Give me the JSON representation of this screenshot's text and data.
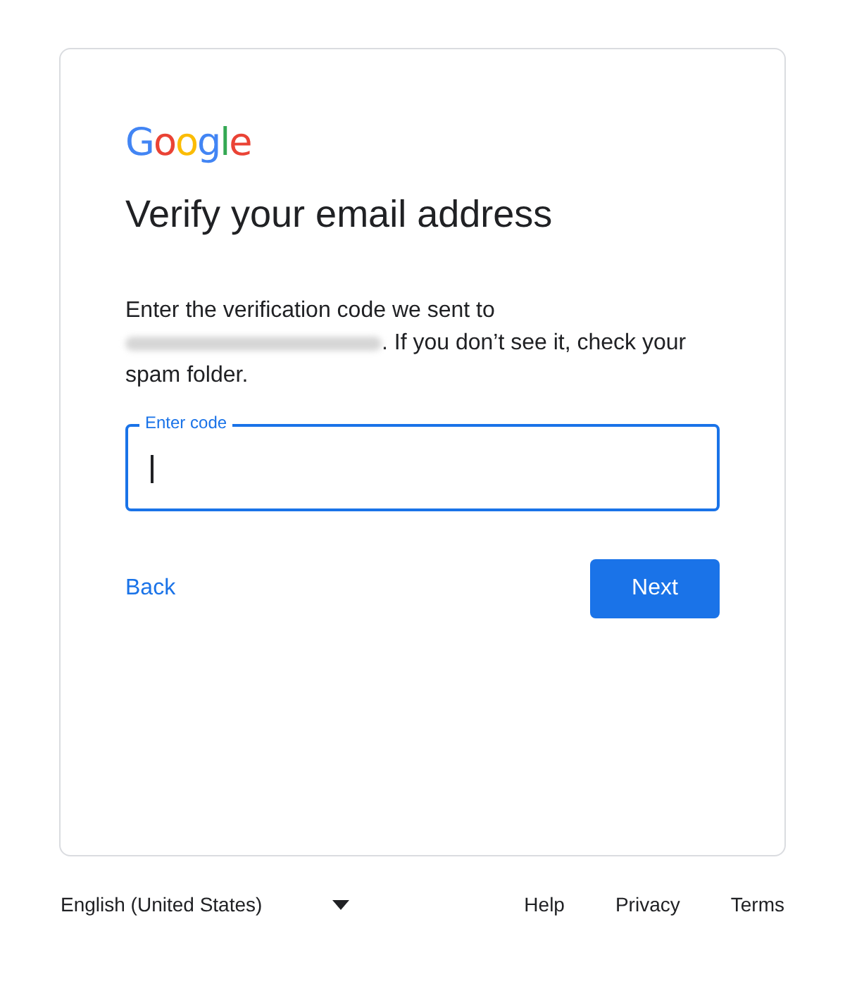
{
  "logo": {
    "letters": [
      {
        "char": "G",
        "color": "#4285f4"
      },
      {
        "char": "o",
        "color": "#ea4335"
      },
      {
        "char": "o",
        "color": "#fbbc05"
      },
      {
        "char": "g",
        "color": "#4285f4"
      },
      {
        "char": "l",
        "color": "#34a853"
      },
      {
        "char": "e",
        "color": "#ea4335"
      }
    ]
  },
  "title": "Verify your email address",
  "message": {
    "before": "Enter the verification code we sent to",
    "after": ". If you don’t see it, check your",
    "last_line": "spam folder."
  },
  "code_field": {
    "label": "Enter code",
    "focused": true
  },
  "back_button": "Back",
  "next_button": "Next",
  "footer": {
    "language": "English (United States)",
    "links": [
      "Help",
      "Privacy",
      "Terms"
    ]
  }
}
